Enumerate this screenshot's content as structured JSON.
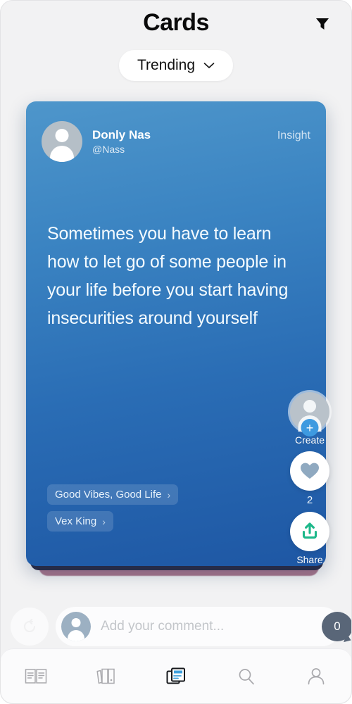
{
  "header": {
    "title": "Cards",
    "filter_icon": "filter-funnel-icon"
  },
  "sort": {
    "label": "Trending",
    "chevron_icon": "chevron-down-icon"
  },
  "card": {
    "author_name": "Donly Nas",
    "author_handle": "@Nass",
    "kind": "Insight",
    "quote": "Sometimes you have to learn how to let go of some people in your life before you start having insecurities around yourself",
    "avatar_icon": "person-avatar-icon",
    "gradient_top": "#4e96cb",
    "gradient_bottom": "#1e57a4",
    "tags": [
      {
        "label": "Good Vibes, Good Life",
        "arrow": "›"
      },
      {
        "label": "Vex King",
        "arrow": "›"
      }
    ]
  },
  "rail": {
    "create": {
      "label": "Create",
      "icon": "person-plus-icon",
      "badge": "+",
      "badge_color": "#3e9ae0"
    },
    "like": {
      "count": "2",
      "icon": "heart-icon",
      "icon_color": "#8fa9c0"
    },
    "share": {
      "label": "Share",
      "icon": "share-upload-icon",
      "icon_color": "#1db88a"
    }
  },
  "comment": {
    "reset_icon": "refresh-reset-icon",
    "avatar_icon": "person-avatar-icon",
    "placeholder": "Add your comment...",
    "value": "",
    "count": "0",
    "count_icon": "speech-bubble-icon"
  },
  "bottom_nav": {
    "items": [
      {
        "name": "read",
        "icon": "open-book-icon",
        "active": false
      },
      {
        "name": "library",
        "icon": "bookshelf-icon",
        "active": false
      },
      {
        "name": "cards",
        "icon": "stacked-cards-icon",
        "active": true
      },
      {
        "name": "search",
        "icon": "search-icon",
        "active": false
      },
      {
        "name": "profile",
        "icon": "person-icon",
        "active": false
      }
    ]
  }
}
